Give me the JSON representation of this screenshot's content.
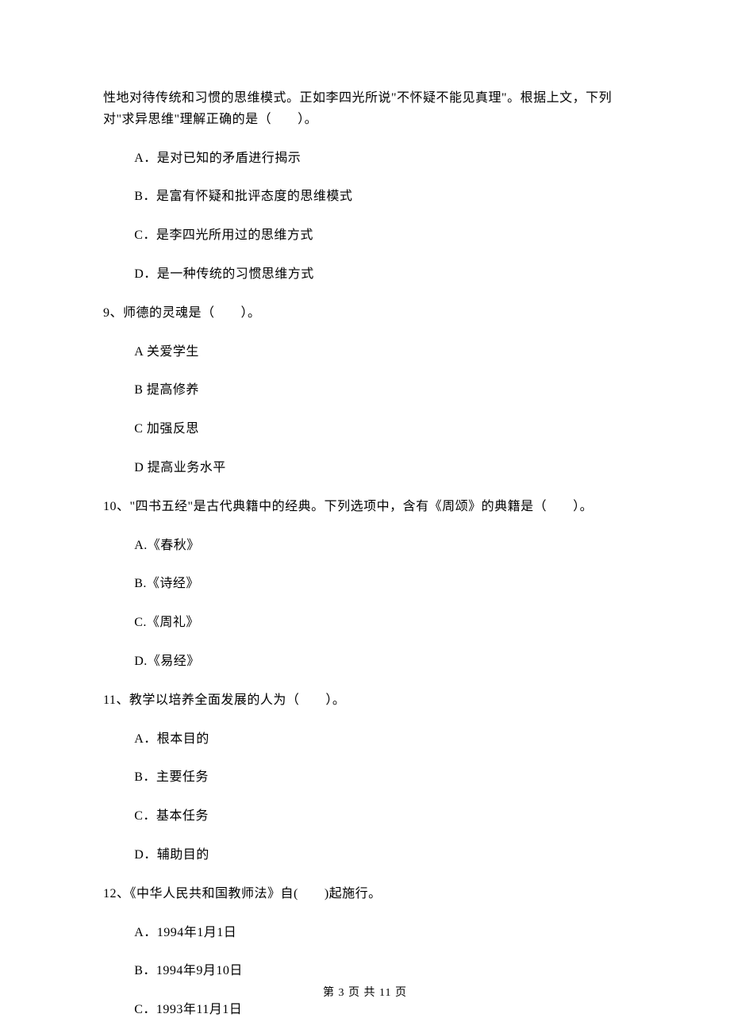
{
  "passage": {
    "line1": "性地对待传统和习惯的思维模式。正如李四光所说\"不怀疑不能见真理\"。根据上文，下列",
    "line2": "对\"求异思维\"理解正确的是（　　）。"
  },
  "q8_options": {
    "A": "A．是对已知的矛盾进行揭示",
    "B": "B．是富有怀疑和批评态度的思维模式",
    "C": "C．是李四光所用过的思维方式",
    "D": "D．是一种传统的习惯思维方式"
  },
  "q9": {
    "stem": "9、师德的灵魂是（　　）。",
    "options": {
      "A": "A 关爱学生",
      "B": "B 提高修养",
      "C": "C 加强反思",
      "D": "D 提高业务水平"
    }
  },
  "q10": {
    "stem": "10、\"四书五经\"是古代典籍中的经典。下列选项中，含有《周颂》的典籍是（　　）。",
    "options": {
      "A": "A.《春秋》",
      "B": "B.《诗经》",
      "C": "C.《周礼》",
      "D": "D.《易经》"
    }
  },
  "q11": {
    "stem": "11、教学以培养全面发展的人为（　　）。",
    "options": {
      "A": "A．根本目的",
      "B": "B．主要任务",
      "C": "C．基本任务",
      "D": "D．辅助目的"
    }
  },
  "q12": {
    "stem": "12、《中华人民共和国教师法》自(　　)起施行。",
    "options": {
      "A": "A．1994年1月1日",
      "B": "B．1994年9月10日",
      "C": "C．1993年11月1日"
    }
  },
  "footer": "第 3 页 共 11 页"
}
